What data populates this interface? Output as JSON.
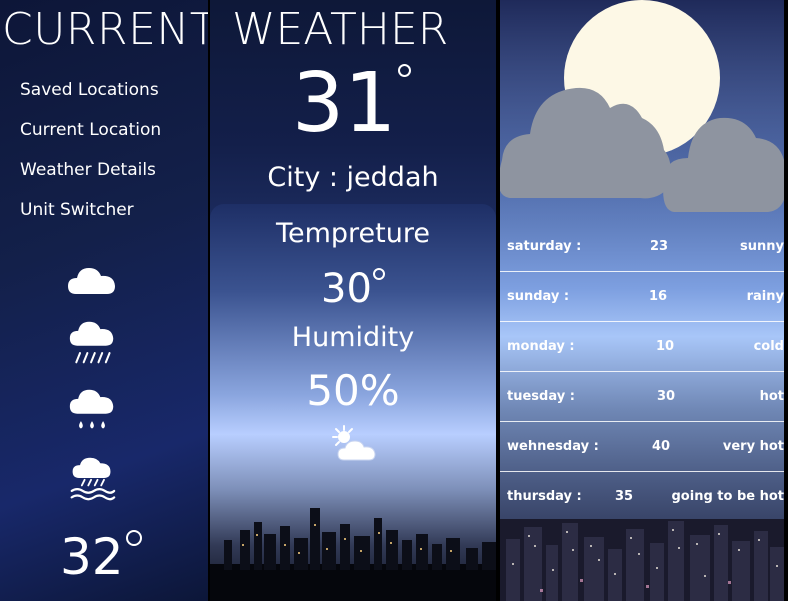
{
  "header": {
    "title_left": "CURRENT",
    "title_right": "WEATHER"
  },
  "nav": {
    "items": [
      {
        "label": "Saved Locations"
      },
      {
        "label": "Current Location"
      },
      {
        "label": "Weather Details"
      },
      {
        "label": "Unit Switcher"
      }
    ]
  },
  "left": {
    "icons": [
      "cloud-icon",
      "rain-cloud-icon",
      "drizzle-cloud-icon",
      "hail-cloud-icon"
    ],
    "temperature": "32"
  },
  "current": {
    "temperature": "31",
    "city": "City : jeddah",
    "temp_label": "Tempreture",
    "temp_value": "30",
    "humidity_label": "Humidity",
    "humidity_value": "50%",
    "icon": "sun-behind-cloud-icon"
  },
  "forecast": [
    {
      "day": "saturday :",
      "value": "23",
      "condition": "sunny"
    },
    {
      "day": "sunday :",
      "value": "16",
      "condition": "rainy"
    },
    {
      "day": "monday :",
      "value": "10",
      "condition": "cold"
    },
    {
      "day": "tuesday :",
      "value": "30",
      "condition": "hot"
    },
    {
      "day": "wehnesday :",
      "value": "40",
      "condition": "very hot"
    },
    {
      "day": "thursday :",
      "value": "35",
      "condition": "going to be hot"
    }
  ],
  "colors": {
    "panel_dark": "#0f1a3e",
    "moon": "#fdf8e6",
    "cloud": "#8e94a0",
    "text": "#ffffff"
  }
}
